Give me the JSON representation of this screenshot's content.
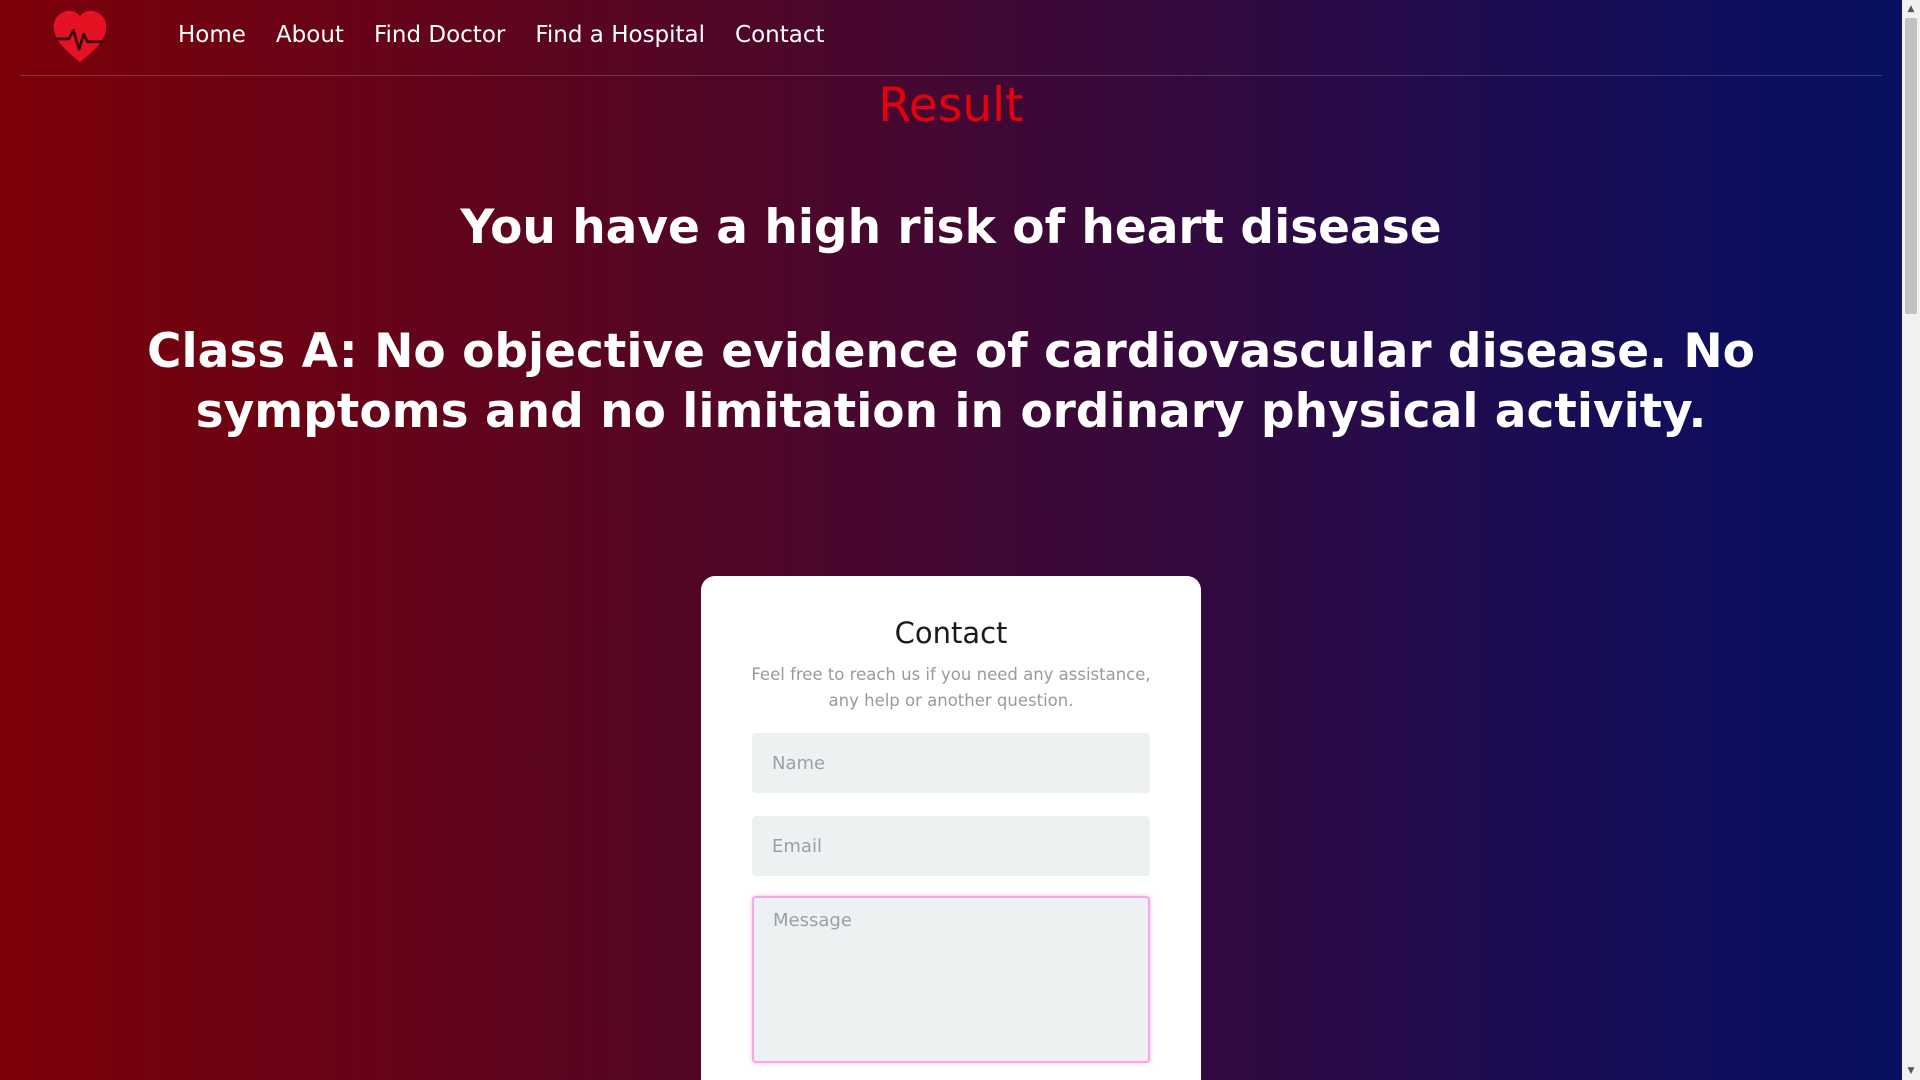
{
  "nav": {
    "logo_icon": "heart-pulse-icon",
    "links": [
      "Home",
      "About",
      "Find Doctor",
      "Find a Hospital",
      "Contact"
    ]
  },
  "result": {
    "title": "Result",
    "risk_message": "You have a high risk of heart disease",
    "class_message": "Class A: No objective evidence of cardiovascular disease. No symptoms and no limitation in ordinary physical activity."
  },
  "contact": {
    "title": "Contact",
    "description": "Feel free to reach us if you need any assistance, any help or another question.",
    "name_placeholder": "Name",
    "email_placeholder": "Email",
    "message_placeholder": "Message"
  },
  "colors": {
    "accent": "#e3000f",
    "gradient_start": "#7d0009",
    "gradient_end": "#07115f"
  }
}
